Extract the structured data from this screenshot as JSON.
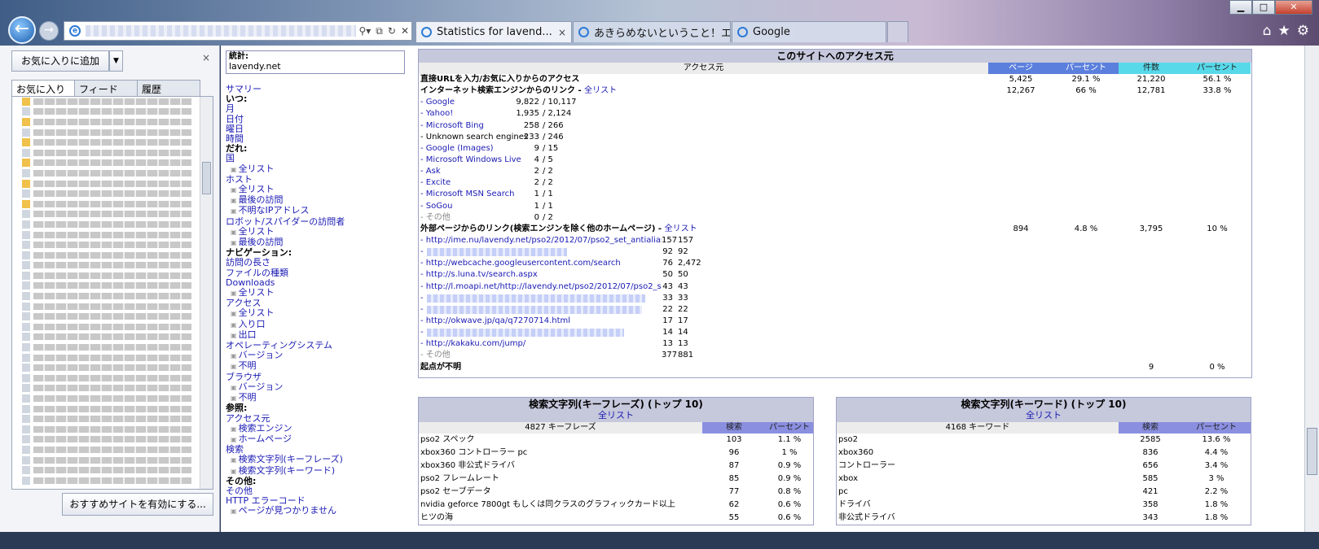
{
  "browser": {
    "tabs": [
      {
        "label": "Statistics for lavend...",
        "close": "×"
      },
      {
        "label": "あきらめないということ！エン..."
      },
      {
        "label": "Google"
      }
    ],
    "window_controls": {
      "minimize": "▁",
      "maximize": "□",
      "close": "✕"
    },
    "toolbar_icons": {
      "home": "⌂",
      "star": "★",
      "gear": "⚙"
    }
  },
  "favorites": {
    "add_button": "お気に入りに追加",
    "dropdown": "▼",
    "close": "×",
    "tabs": [
      "お気に入り",
      "フィード",
      "履歴"
    ],
    "suggest_button": "おすすめサイトを有効にする..."
  },
  "nav": {
    "stat_label": "統計:",
    "site": "lavendy.net",
    "items": [
      {
        "t": "link",
        "text": "サマリー"
      },
      {
        "t": "hd",
        "text": "いつ:"
      },
      {
        "t": "link",
        "text": "月"
      },
      {
        "t": "link",
        "text": "日付"
      },
      {
        "t": "link",
        "text": "曜日"
      },
      {
        "t": "link",
        "text": "時間"
      },
      {
        "t": "hd",
        "text": "だれ:"
      },
      {
        "t": "link",
        "text": "国"
      },
      {
        "t": "sub",
        "text": "全リスト"
      },
      {
        "t": "link",
        "text": "ホスト"
      },
      {
        "t": "sub",
        "text": "全リスト"
      },
      {
        "t": "sub",
        "text": "最後の訪問"
      },
      {
        "t": "sub",
        "text": "不明なIPアドレス"
      },
      {
        "t": "link",
        "text": "ロボット/スパイダーの訪問者"
      },
      {
        "t": "sub",
        "text": "全リスト"
      },
      {
        "t": "sub",
        "text": "最後の訪問"
      },
      {
        "t": "hd",
        "text": "ナビゲーション:"
      },
      {
        "t": "link",
        "text": "訪問の長さ"
      },
      {
        "t": "link",
        "text": "ファイルの種類"
      },
      {
        "t": "link",
        "text": "Downloads"
      },
      {
        "t": "sub",
        "text": "全リスト"
      },
      {
        "t": "link",
        "text": "アクセス"
      },
      {
        "t": "sub",
        "text": "全リスト"
      },
      {
        "t": "sub",
        "text": "入り口"
      },
      {
        "t": "sub",
        "text": "出口"
      },
      {
        "t": "link",
        "text": "オペレーティングシステム"
      },
      {
        "t": "sub",
        "text": "バージョン"
      },
      {
        "t": "sub",
        "text": "不明"
      },
      {
        "t": "link",
        "text": "ブラウザ"
      },
      {
        "t": "sub",
        "text": "バージョン"
      },
      {
        "t": "sub",
        "text": "不明"
      },
      {
        "t": "hd",
        "text": "参照:"
      },
      {
        "t": "link",
        "text": "アクセス元"
      },
      {
        "t": "sub",
        "text": "検索エンジン"
      },
      {
        "t": "sub",
        "text": "ホームページ"
      },
      {
        "t": "link",
        "text": "検索"
      },
      {
        "t": "sub",
        "text": "検索文字列(キーフレーズ)"
      },
      {
        "t": "sub",
        "text": "検索文字列(キーワード)"
      },
      {
        "t": "hd",
        "text": "その他:"
      },
      {
        "t": "link",
        "text": "その他"
      },
      {
        "t": "link",
        "text": "HTTP エラーコード"
      },
      {
        "t": "sub",
        "text": "ページが見つかりません"
      }
    ]
  },
  "referrers": {
    "title": "このサイトへのアクセス元",
    "col_source": "アクセス元",
    "col_pages": "ページ",
    "col_pct1": "パーセント",
    "col_hits": "件数",
    "col_pct2": "パーセント",
    "rows": [
      {
        "kind": "bold",
        "label": "直接URLを入力/お気に入りからのアクセス",
        "pages": "5,425",
        "p1": "29.1 %",
        "hits": "21,220",
        "p2": "56.1 %"
      },
      {
        "kind": "bold",
        "label": "インターネット検索エンジンからのリンク",
        "link": "全リスト",
        "pages": "12,267",
        "p1": "66 %",
        "hits": "12,781",
        "p2": "33.8 %"
      },
      {
        "kind": "engine",
        "name": "- Google",
        "a": "9,822",
        "b": "/ 10,117"
      },
      {
        "kind": "engine",
        "name": "- Yahoo!",
        "a": "1,935",
        "b": "/ 2,124"
      },
      {
        "kind": "engine",
        "name": "- Microsoft Bing",
        "a": "258",
        "b": "/ 266"
      },
      {
        "kind": "engine",
        "name": "- Unknown search engines",
        "a": "233",
        "b": "/ 246",
        "plain": true
      },
      {
        "kind": "engine",
        "name": "- Google (Images)",
        "a": "9",
        "b": "/ 15"
      },
      {
        "kind": "engine",
        "name": "- Microsoft Windows Live",
        "a": "4",
        "b": "/ 5"
      },
      {
        "kind": "engine",
        "name": "- Ask",
        "a": "2",
        "b": "/ 2"
      },
      {
        "kind": "engine",
        "name": "- Excite",
        "a": "2",
        "b": "/ 2"
      },
      {
        "kind": "engine",
        "name": "- Microsoft MSN Search",
        "a": "1",
        "b": "/ 1"
      },
      {
        "kind": "engine",
        "name": "- SoGou",
        "a": "1",
        "b": "/ 1"
      },
      {
        "kind": "engine",
        "name": "- その他",
        "a": "0",
        "b": "/ 2",
        "grey": true
      },
      {
        "kind": "bold",
        "label": "外部ページからのリンク(検索エンジンを除く他のホームページ)",
        "link": "全リスト",
        "pages": "894",
        "p1": "4.8 %",
        "hits": "3,795",
        "p2": "10 %"
      },
      {
        "kind": "url",
        "url": "- http://ime.nu/lavendy.net/pso2/2012/07/pso2_set_antialiasing_ob...",
        "a": "157",
        "b": "157"
      },
      {
        "kind": "url",
        "url": "-",
        "blur": 172,
        "a": "92",
        "b": "92"
      },
      {
        "kind": "url",
        "url": "- http://webcache.googleusercontent.com/search",
        "a": "76",
        "b": "2,472"
      },
      {
        "kind": "url",
        "url": "- http://s.luna.tv/search.aspx",
        "a": "50",
        "b": "50"
      },
      {
        "kind": "url",
        "url": "- http://l.moapi.net/http://lavendy.net/pso2/2012/07/pso2_set_anti...",
        "a": "43",
        "b": "43"
      },
      {
        "kind": "url",
        "url": "-",
        "blur": 268,
        "a": "33",
        "b": "33"
      },
      {
        "kind": "url",
        "url": "-",
        "blur": 264,
        "a": "22",
        "b": "22"
      },
      {
        "kind": "url",
        "url": "- http://okwave.jp/qa/q7270714.html",
        "a": "17",
        "b": "17"
      },
      {
        "kind": "url",
        "url": "-",
        "blur": 242,
        "a": "14",
        "b": "14"
      },
      {
        "kind": "url",
        "url": "- http://kakaku.com/jump/",
        "a": "13",
        "b": "13"
      },
      {
        "kind": "url",
        "url": "- その他",
        "grey": true,
        "a": "377",
        "b": "881"
      },
      {
        "kind": "bold",
        "label": "起点が不明",
        "pages": "",
        "p1": "",
        "hits": "9",
        "p2": "0 %"
      }
    ]
  },
  "keyphrases": {
    "title": "検索文字列(キーフレーズ) (トップ 10)",
    "link": "全リスト",
    "col_a": "4827 キーフレーズ",
    "col_b": "検索",
    "col_c": "パーセント",
    "rows": [
      [
        "pso2 スペック",
        "103",
        "1.1 %"
      ],
      [
        "xbox360 コントローラー pc",
        "96",
        "1 %"
      ],
      [
        "xbox360 非公式ドライバ",
        "87",
        "0.9 %"
      ],
      [
        "pso2 フレームレート",
        "85",
        "0.9 %"
      ],
      [
        "pso2 セーブデータ",
        "77",
        "0.8 %"
      ],
      [
        "nvidia geforce 7800gt もしくは同クラスのグラフィックカード以上",
        "62",
        "0.6 %"
      ],
      [
        "ヒツの海",
        "55",
        "0.6 %"
      ]
    ]
  },
  "keywords": {
    "title": "検索文字列(キーワード) (トップ 10)",
    "link": "全リスト",
    "col_a": "4168 キーワード",
    "col_b": "検索",
    "col_c": "パーセント",
    "rows": [
      [
        "pso2",
        "2585",
        "13.6 %"
      ],
      [
        "xbox360",
        "836",
        "4.4 %"
      ],
      [
        "コントローラー",
        "656",
        "3.4 %"
      ],
      [
        "xbox",
        "585",
        "3 %"
      ],
      [
        "pc",
        "421",
        "2.2 %"
      ],
      [
        "ドライバ",
        "358",
        "1.8 %"
      ],
      [
        "非公式ドライバ",
        "343",
        "1.8 %"
      ]
    ]
  }
}
